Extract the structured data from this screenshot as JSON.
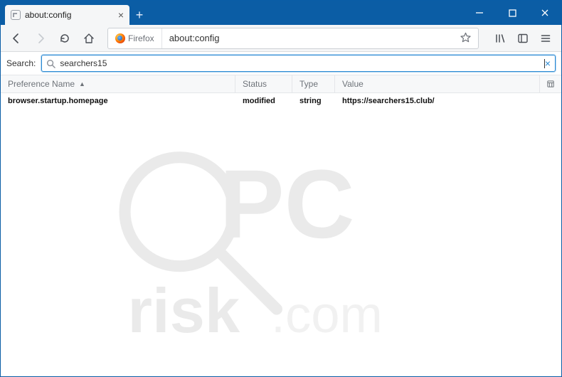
{
  "tab": {
    "title": "about:config"
  },
  "address": {
    "browser_label": "Firefox",
    "url": "about:config"
  },
  "search": {
    "label": "Search:",
    "value": "searchers15",
    "placeholder": ""
  },
  "columns": {
    "name": "Preference Name",
    "status": "Status",
    "type": "Type",
    "value": "Value"
  },
  "rows": [
    {
      "name": "browser.startup.homepage",
      "status": "modified",
      "type": "string",
      "value": "https://searchers15.club/"
    }
  ]
}
